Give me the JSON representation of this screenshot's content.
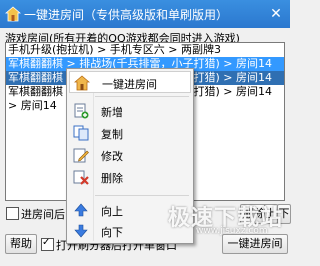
{
  "window": {
    "title": "一键进房间（专供高级版和单刷版用）",
    "close_glyph": "✕"
  },
  "group_label": "游戏房间(所有开着的QQ游戏都会同时进入游戏)",
  "rooms": [
    {
      "text": "手机升级(抱拉机) > 手机专区六 > 两副牌3",
      "state": "normal"
    },
    {
      "text": "军棋翻翻棋 > 排战场(千兵排雷，小子打猎) > 房间14",
      "state": "selected"
    },
    {
      "text": "军棋翻翻棋 > 排战场(千兵排雷，小子打猎) > 房间14",
      "state": "selected-dim"
    },
    {
      "text": "军棋翻翻棋 > 排战场(千兵排雷，小子打猎) > 房间14",
      "state": "normal"
    },
    {
      "text": " > 房间14",
      "state": "normal"
    }
  ],
  "context_menu": {
    "items": [
      {
        "label": "一键进房间",
        "icon": "house-icon",
        "color": "#e8a33a"
      },
      {
        "label": "新增",
        "icon": "add-icon",
        "color": "#2e8b2e"
      },
      {
        "label": "复制",
        "icon": "copy-icon",
        "color": "#3a6fc4"
      },
      {
        "label": "修改",
        "icon": "edit-icon",
        "color": "#3a6fc4"
      },
      {
        "label": "删除",
        "icon": "delete-icon",
        "color": "#d23a2a"
      },
      {
        "label": "向上",
        "icon": "arrow-up-icon",
        "color": "#2f6fd0"
      },
      {
        "label": "向下",
        "icon": "arrow-down-icon",
        "color": "#2f6fd0"
      }
    ]
  },
  "bottom": {
    "enter_room_checkbox_label": "进房间后",
    "delete_button": "删除",
    "up_button": "上",
    "down_button": "下",
    "help_button": "帮助",
    "open_refresher_label": "打开刷分器后打开单窗口",
    "enter_room_button": "一键进房间"
  },
  "watermark": {
    "main": "极速下载站",
    "sub": "www.jisuxz.com"
  }
}
